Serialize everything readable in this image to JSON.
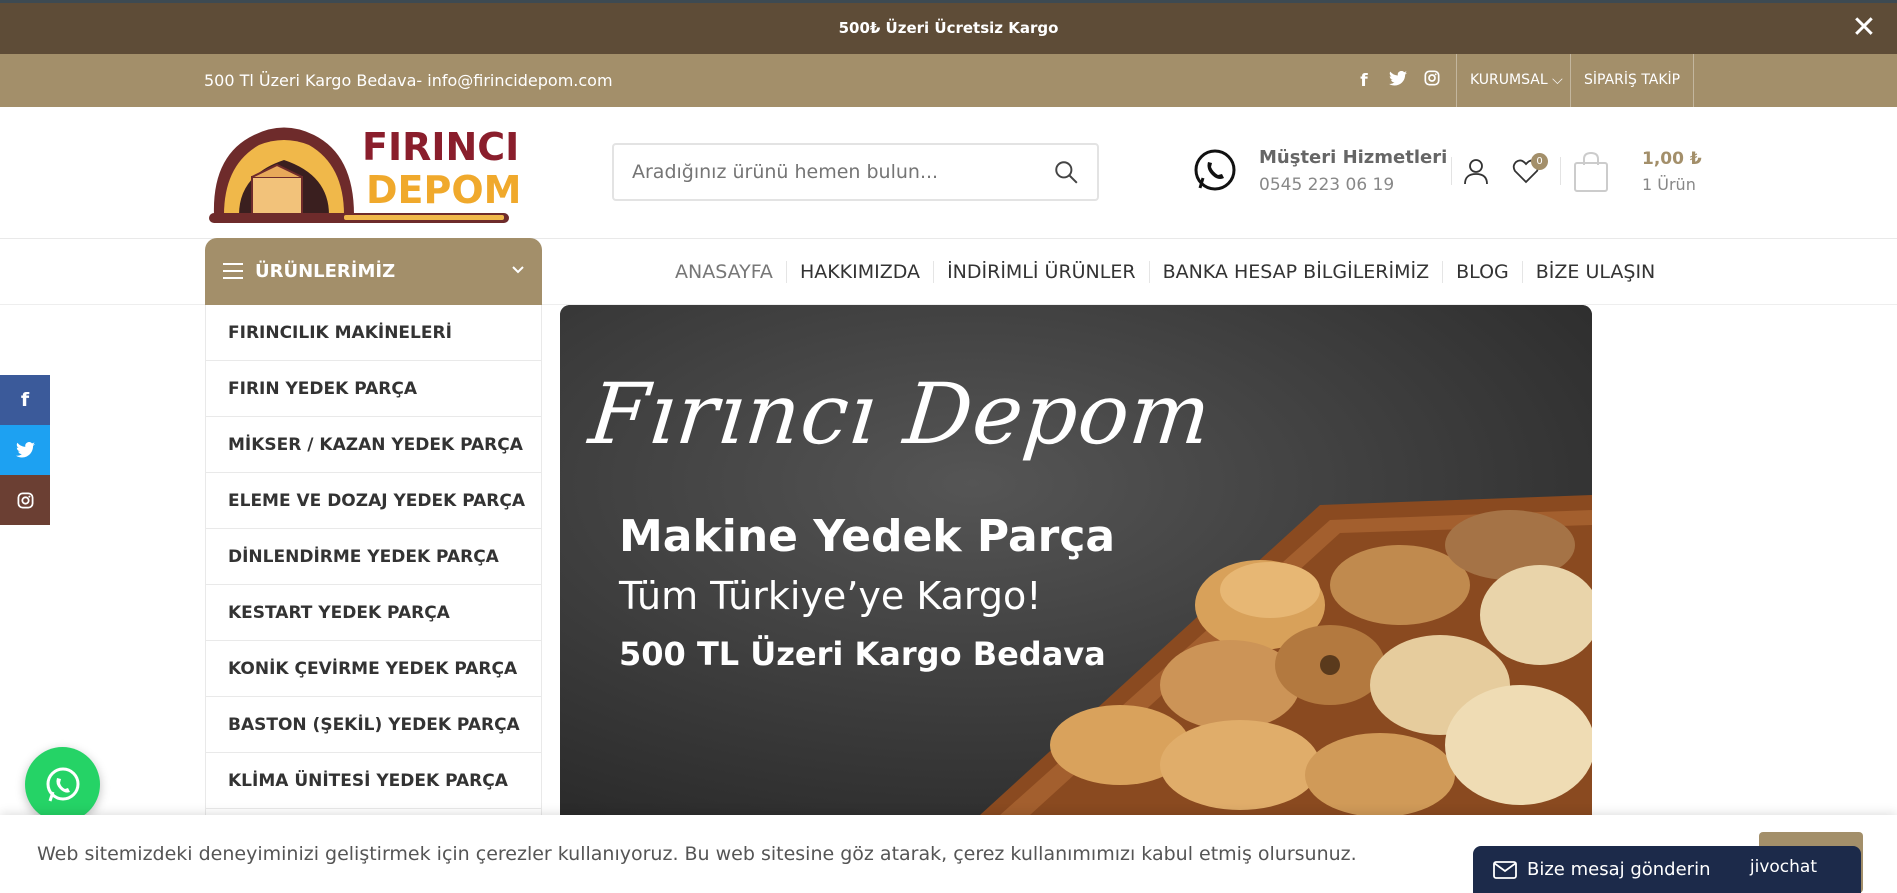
{
  "topbar": {
    "message": "500₺ Üzeri Ücretsiz Kargo",
    "close": "✕"
  },
  "infobar": {
    "left_text": "500 Tl Üzeri Kargo Bedava- info@firincidepom.com",
    "social": [
      "facebook-icon",
      "twitter-icon",
      "instagram-icon"
    ],
    "kurumsal": "KURUMSAL ⌵",
    "siparis": "SİPARİŞ TAKİP"
  },
  "logo": {
    "line1": "FIRINCI",
    "line2": "DEPOM"
  },
  "search": {
    "placeholder": "Aradığınız ürünü hemen bulun..."
  },
  "support": {
    "title": "Müşteri Hizmetleri",
    "phone": "0545 223 06 19"
  },
  "wishlist": {
    "count": "0"
  },
  "cart": {
    "price": "1,00 ₺",
    "count": "1 Ürün"
  },
  "categories": {
    "title": "ÜRÜNLERİMİZ",
    "items": [
      "FIRINCILIK MAKİNELERİ",
      "FIRIN YEDEK PARÇA",
      "MİKSER / KAZAN YEDEK PARÇA",
      "ELEME VE DOZAJ YEDEK PARÇA",
      "DİNLENDİRME YEDEK PARÇA",
      "KESTART YEDEK PARÇA",
      "KONİK ÇEVİRME YEDEK PARÇA",
      "BASTON (ŞEKİL) YEDEK PARÇA",
      "KLİMA ÜNİTESİ YEDEK PARÇA"
    ]
  },
  "nav": [
    "ANASAYFA",
    "HAKKIMIZDA",
    "İNDİRİMLİ ÜRÜNLER",
    "BANKA HESAP BİLGİLERİMİZ",
    "BLOG",
    "BİZE ULAŞIN"
  ],
  "banner": {
    "script": "Fırıncı Depom",
    "line1": "Makine Yedek Parça",
    "line2": "Tüm Türkiye’ye Kargo!",
    "line3": "500 TL Üzeri Kargo Bedava"
  },
  "cookie": {
    "text": "Web sitemizdeki deneyiminizi geliştirmek için çerezler kullanıyoruz. Bu web sitesine göz atarak, çerez kullanımımızı kabul etmiş olursunuz."
  },
  "chat": {
    "label": "Bize mesaj gönderin",
    "brand": "jivochat"
  },
  "colors": {
    "brown_dark": "#5e4c37",
    "tan": "#a38f6a",
    "navy": "#1c2a4a",
    "whatsapp": "#25d366"
  }
}
